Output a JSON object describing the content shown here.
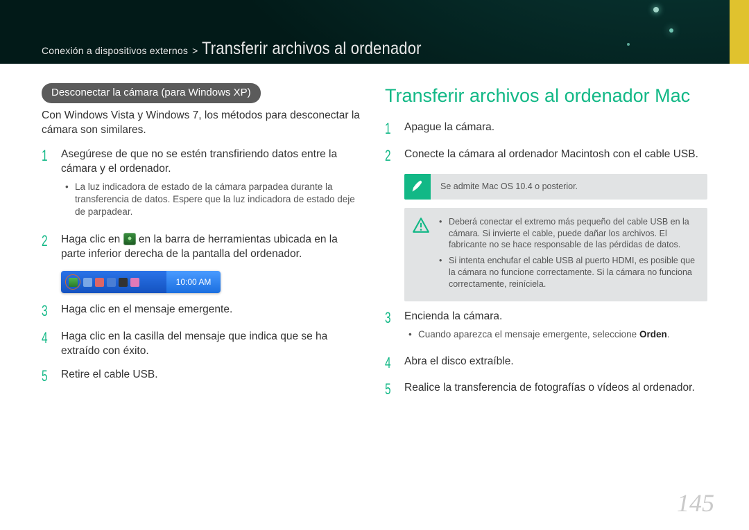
{
  "breadcrumb": {
    "section": "Conexión a dispositivos externos",
    "separator": ">",
    "title": "Transferir archivos al ordenador"
  },
  "left": {
    "pill": "Desconectar la cámara (para Windows XP)",
    "intro": "Con Windows Vista y Windows 7, los métodos para desconectar la cámara son similares.",
    "steps": {
      "s1": {
        "num": "1",
        "text": "Asegúrese de que no se estén transfiriendo datos entre la cámara y el ordenador.",
        "bullet": "La luz indicadora de estado de la cámara parpadea durante la transferencia de datos. Espere que la luz indicadora de estado deje de parpadear."
      },
      "s2": {
        "num": "2",
        "pre": "Haga clic en ",
        "post": " en la barra de herramientas ubicada en la parte inferior derecha de la pantalla del ordenador."
      },
      "s3": {
        "num": "3",
        "text": "Haga clic en el mensaje emergente."
      },
      "s4": {
        "num": "4",
        "text": "Haga clic en la casilla del mensaje que indica que se ha extraído con éxito."
      },
      "s5": {
        "num": "5",
        "text": "Retire el cable USB."
      }
    },
    "taskbar_time": "10:00 AM"
  },
  "right": {
    "heading": "Transferir archivos al ordenador Mac",
    "steps": {
      "s1": {
        "num": "1",
        "text": "Apague la cámara."
      },
      "s2": {
        "num": "2",
        "text": "Conecte la cámara al ordenador Macintosh con el cable USB."
      },
      "s3": {
        "num": "3",
        "text": "Encienda la cámara.",
        "bullet_pre": "Cuando aparezca el mensaje emergente, seleccione ",
        "bullet_bold": "Orden",
        "bullet_post": "."
      },
      "s4": {
        "num": "4",
        "text": "Abra el disco extraíble."
      },
      "s5": {
        "num": "5",
        "text": "Realice la transferencia de fotografías o vídeos al ordenador."
      }
    },
    "note_pen": "Se admite Mac OS 10.4 o posterior.",
    "warn": {
      "b1": "Deberá conectar el extremo más pequeño del cable USB en la cámara. Si invierte el cable, puede dañar los archivos. El fabricante no se hace responsable de las pérdidas de datos.",
      "b2": "Si intenta enchufar el cable USB al puerto HDMI, es posible que la cámara no funcione correctamente. Si la cámara no funciona correctamente, reiníciela."
    }
  },
  "page_number": "145"
}
